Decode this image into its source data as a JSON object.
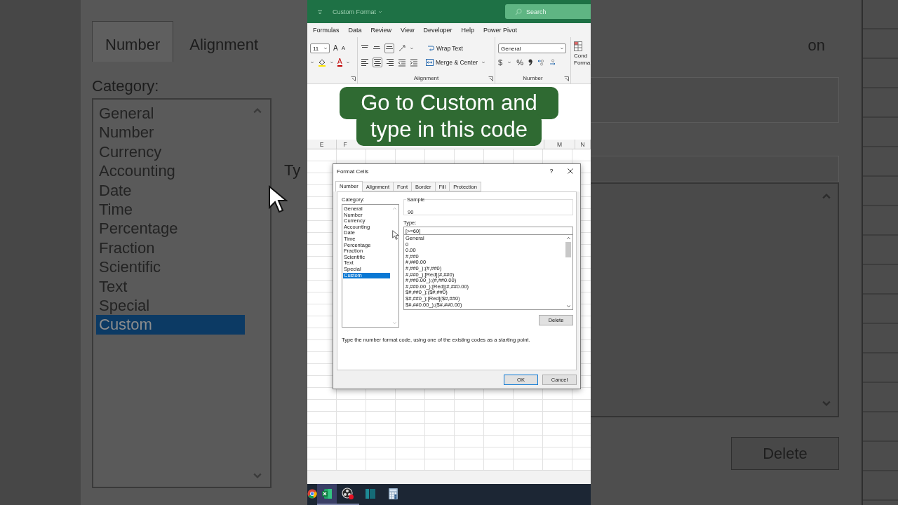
{
  "backdrop_left": {
    "tabs": [
      {
        "label": "Number",
        "selected": true
      },
      {
        "label": "Alignment",
        "selected": false
      }
    ],
    "category_label": "Category:",
    "categories": [
      {
        "label": "General",
        "selected": false
      },
      {
        "label": "Number",
        "selected": false
      },
      {
        "label": "Currency",
        "selected": false
      },
      {
        "label": "Accounting",
        "selected": false
      },
      {
        "label": "Date",
        "selected": false
      },
      {
        "label": "Time",
        "selected": false
      },
      {
        "label": "Percentage",
        "selected": false
      },
      {
        "label": "Fraction",
        "selected": false
      },
      {
        "label": "Scientific",
        "selected": false
      },
      {
        "label": "Text",
        "selected": false
      },
      {
        "label": "Special",
        "selected": false
      },
      {
        "label": "Custom",
        "selected": true
      }
    ],
    "type_label": "Ty"
  },
  "backdrop_right": {
    "tab_fragment": "on",
    "delete_button": "Delete"
  },
  "title_bar": {
    "document": "Custom Format",
    "search_placeholder": "Search"
  },
  "menu": [
    "Formulas",
    "Data",
    "Review",
    "View",
    "Developer",
    "Help",
    "Power Pivot"
  ],
  "ribbon": {
    "font_size": "11",
    "font_grow": "A",
    "font_shrink": "A",
    "font_color": "A",
    "wrap_text": "Wrap Text",
    "merge_center": "Merge & Center",
    "alignment_label": "Alignment",
    "number_format": "General",
    "currency": "$",
    "percent": "%",
    "number_label": "Number",
    "conditional_lines": [
      "Cond",
      "Forma"
    ]
  },
  "caption_lines": [
    "Go to Custom and",
    "type in this code"
  ],
  "columns": [
    "E",
    "F",
    "M",
    "N"
  ],
  "dialog": {
    "title": "Format Cells",
    "help": "?",
    "tabs": [
      {
        "label": "Number",
        "selected": true
      },
      {
        "label": "Alignment",
        "selected": false
      },
      {
        "label": "Font",
        "selected": false
      },
      {
        "label": "Border",
        "selected": false
      },
      {
        "label": "Fill",
        "selected": false
      },
      {
        "label": "Protection",
        "selected": false
      }
    ],
    "category_label": "Category:",
    "categories": [
      {
        "label": "General",
        "selected": false
      },
      {
        "label": "Number",
        "selected": false
      },
      {
        "label": "Currency",
        "selected": false
      },
      {
        "label": "Accounting",
        "selected": false
      },
      {
        "label": "Date",
        "selected": false
      },
      {
        "label": "Time",
        "selected": false
      },
      {
        "label": "Percentage",
        "selected": false
      },
      {
        "label": "Fraction",
        "selected": false
      },
      {
        "label": "Scientific",
        "selected": false
      },
      {
        "label": "Text",
        "selected": false
      },
      {
        "label": "Special",
        "selected": false
      },
      {
        "label": "Custom",
        "selected": true
      }
    ],
    "sample_label": "Sample",
    "sample_value": "90",
    "type_label": "Type:",
    "type_value": "[>=60]",
    "type_list": [
      "General",
      "0",
      "0.00",
      "#,##0",
      "#,##0.00",
      "#,##0_);(#,##0)",
      "#,##0_);[Red](#,##0)",
      "#,##0.00_);(#,##0.00)",
      "#,##0.00_);[Red](#,##0.00)",
      "$#,##0_);($#,##0)",
      "$#,##0_);[Red]($#,##0)",
      "$#,##0.00_);($#,##0.00)"
    ],
    "delete_button": "Delete",
    "description": "Type the number format code, using one of the existing codes as a starting point.",
    "ok_button": "OK",
    "cancel_button": "Cancel"
  },
  "taskbar": [
    {
      "kind": "browser",
      "selected": false,
      "running": false
    },
    {
      "kind": "spreadsheet",
      "selected": true,
      "running": true
    },
    {
      "kind": "recorder",
      "selected": false,
      "running": true
    },
    {
      "kind": "panel",
      "selected": false,
      "running": false
    },
    {
      "kind": "calculator",
      "selected": false,
      "running": false
    }
  ]
}
